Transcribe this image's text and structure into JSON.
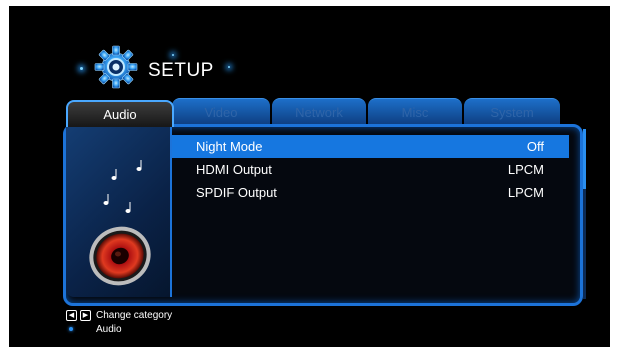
{
  "header": {
    "title": "SETUP"
  },
  "tabs": [
    {
      "label": "Audio",
      "active": true
    },
    {
      "label": "Video",
      "active": false
    },
    {
      "label": "Network",
      "active": false
    },
    {
      "label": "Misc",
      "active": false
    },
    {
      "label": "System",
      "active": false
    }
  ],
  "settings": [
    {
      "label": "Night Mode",
      "value": "Off",
      "selected": true
    },
    {
      "label": "HDMI Output",
      "value": "LPCM",
      "selected": false
    },
    {
      "label": "SPDIF Output",
      "value": "LPCM",
      "selected": false
    }
  ],
  "footer": {
    "left_key": "◀",
    "right_key": "▶",
    "hint": "Change category",
    "current": "Audio"
  },
  "colors": {
    "accent": "#1677e0",
    "panel_border": "#1c73d9",
    "background": "#000000",
    "text": "#ffffff"
  },
  "icons": [
    "gear-icon",
    "speaker-icon",
    "music-note-icon"
  ]
}
